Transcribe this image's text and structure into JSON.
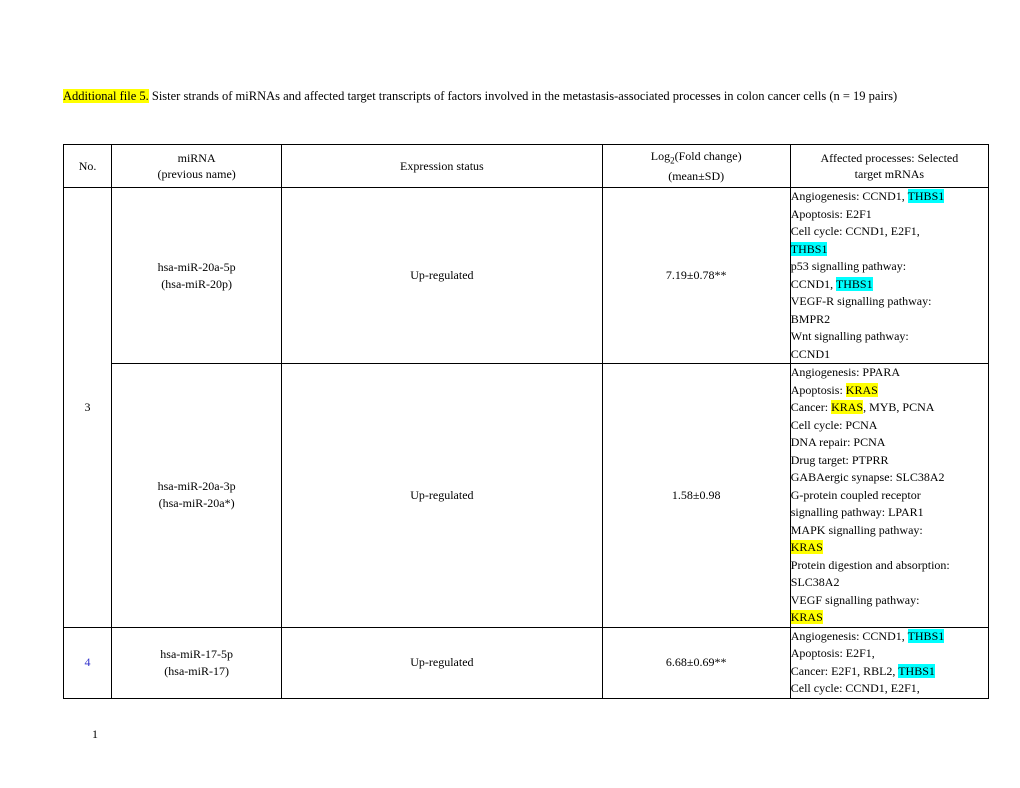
{
  "document": {
    "title_highlight": "Additional file 5.",
    "title_rest": " Sister strands of miRNAs and affected target transcripts of factors involved in the metastasis-associated processes in colon cancer cells (n = 19 pairs)",
    "page_number": "1"
  },
  "table": {
    "headers": {
      "no": "No.",
      "mirna_line1": "miRNA",
      "mirna_line2": "(previous name)",
      "expression": "Expression status",
      "log_line1_pre": "Log",
      "log_line1_sub": "2",
      "log_line1_post": "(Fold change)",
      "log_line2": "(mean±SD)",
      "processes_line1": "Affected processes: Selected",
      "processes_line2": "target mRNAs"
    },
    "groups": [
      {
        "no": "3",
        "no_color": "#000000",
        "rows": [
          {
            "mirna_line1": "hsa-miR-20a-5p",
            "mirna_line2": "(hsa-miR-20p)",
            "expression": "Up-regulated",
            "log": "7.19±0.78**",
            "processes": [
              [
                {
                  "t": "Angiogenesis: CCND1, ",
                  "hl": "none"
                },
                {
                  "t": "THBS1",
                  "hl": "cyan"
                }
              ],
              [
                {
                  "t": "Apoptosis: E2F1",
                  "hl": "none"
                }
              ],
              [
                {
                  "t": "Cell cycle: CCND1, E2F1,",
                  "hl": "none"
                }
              ],
              [
                {
                  "t": "THBS1",
                  "hl": "cyan"
                }
              ],
              [
                {
                  "t": "p53 signalling pathway:",
                  "hl": "none"
                }
              ],
              [
                {
                  "t": "CCND1, ",
                  "hl": "none"
                },
                {
                  "t": "THBS1",
                  "hl": "cyan"
                }
              ],
              [
                {
                  "t": "VEGF-R signalling pathway:",
                  "hl": "none"
                }
              ],
              [
                {
                  "t": "BMPR2",
                  "hl": "none"
                }
              ],
              [
                {
                  "t": "Wnt signalling pathway:",
                  "hl": "none"
                }
              ],
              [
                {
                  "t": "CCND1",
                  "hl": "none"
                }
              ]
            ]
          },
          {
            "mirna_line1": "hsa-miR-20a-3p",
            "mirna_line2": "(hsa-miR-20a*)",
            "expression": "Up-regulated",
            "log": "1.58±0.98",
            "processes": [
              [
                {
                  "t": "Angiogenesis: PPARA",
                  "hl": "none"
                }
              ],
              [
                {
                  "t": "Apoptosis: ",
                  "hl": "none"
                },
                {
                  "t": "KRAS",
                  "hl": "yellow"
                }
              ],
              [
                {
                  "t": "Cancer: ",
                  "hl": "none"
                },
                {
                  "t": "KRAS",
                  "hl": "yellow"
                },
                {
                  "t": ", MYB, PCNA",
                  "hl": "none"
                }
              ],
              [
                {
                  "t": "Cell cycle: PCNA",
                  "hl": "none"
                }
              ],
              [
                {
                  "t": "DNA repair: PCNA",
                  "hl": "none"
                }
              ],
              [
                {
                  "t": "Drug target: PTPRR",
                  "hl": "none"
                }
              ],
              [
                {
                  "t": "GABAergic synapse: SLC38A2",
                  "hl": "none"
                }
              ],
              [
                {
                  "t": "G-protein coupled receptor",
                  "hl": "none"
                }
              ],
              [
                {
                  "t": "signalling pathway: LPAR1",
                  "hl": "none"
                }
              ],
              [
                {
                  "t": "MAPK signalling pathway:",
                  "hl": "none"
                }
              ],
              [
                {
                  "t": "KRAS",
                  "hl": "yellow"
                }
              ],
              [
                {
                  "t": "Protein digestion and absorption:",
                  "hl": "none"
                }
              ],
              [
                {
                  "t": "SLC38A2",
                  "hl": "none"
                }
              ],
              [
                {
                  "t": "VEGF signalling pathway:",
                  "hl": "none"
                }
              ],
              [
                {
                  "t": "KRAS",
                  "hl": "yellow"
                }
              ]
            ]
          }
        ]
      },
      {
        "no": "4",
        "no_color": "#3333cc",
        "rows": [
          {
            "mirna_line1": "hsa-miR-17-5p",
            "mirna_line2": "(hsa-miR-17)",
            "expression": "Up-regulated",
            "log": "6.68±0.69**",
            "processes": [
              [
                {
                  "t": "Angiogenesis: CCND1, ",
                  "hl": "none"
                },
                {
                  "t": "THBS1",
                  "hl": "cyan"
                }
              ],
              [
                {
                  "t": "Apoptosis: E2F1,",
                  "hl": "none"
                }
              ],
              [
                {
                  "t": "Cancer: E2F1, RBL2, ",
                  "hl": "none"
                },
                {
                  "t": "THBS1",
                  "hl": "cyan"
                }
              ],
              [
                {
                  "t": "Cell cycle: CCND1, E2F1,",
                  "hl": "none"
                }
              ]
            ]
          }
        ]
      }
    ]
  }
}
